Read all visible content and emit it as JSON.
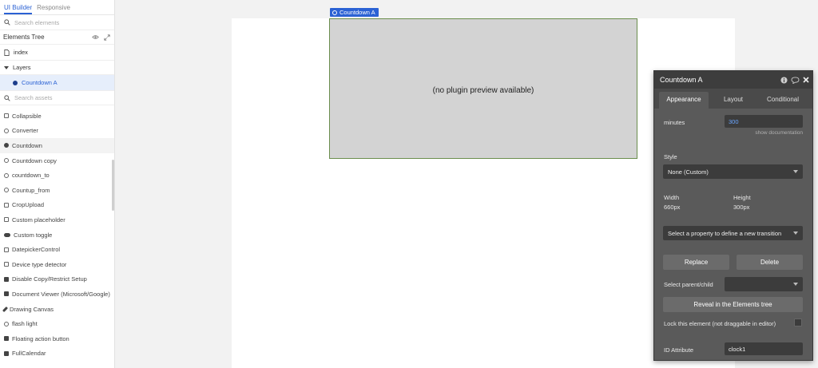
{
  "sidebar": {
    "tabs": [
      "UI Builder",
      "Responsive"
    ],
    "search_elements_placeholder": "Search elements",
    "elements_tree_title": "Elements Tree",
    "page_name": "index",
    "layers_label": "Layers",
    "selected_element": "Countdown A",
    "search_assets_placeholder": "Search assets",
    "assets": [
      "Collapsible",
      "Converter",
      "Countdown",
      "Countdown copy",
      "countdown_to",
      "Countup_from",
      "CropUpload",
      "Custom placeholder",
      "Custom toggle",
      "DatepickerControl",
      "Device type detector",
      "Disable Copy/Restrict Setup",
      "Document Viewer (Microsoft/Google)",
      "Drawing Canvas",
      "flash light",
      "Floating action button",
      "FullCalendar"
    ]
  },
  "canvas": {
    "element_tag": "Countdown A",
    "preview_text": "(no plugin preview available)"
  },
  "panel": {
    "title": "Countdown A",
    "tabs": [
      "Appearance",
      "Layout",
      "Conditional"
    ],
    "minutes_label": "minutes",
    "minutes_value": "300",
    "show_documentation": "show documentation",
    "style_label": "Style",
    "style_value": "None (Custom)",
    "width_label": "Width",
    "width_value": "660px",
    "height_label": "Height",
    "height_value": "300px",
    "transition_placeholder": "Select a property to define a new transition",
    "replace_button": "Replace",
    "delete_button": "Delete",
    "parent_child_label": "Select parent/child",
    "reveal_button": "Reveal in the Elements tree",
    "lock_label": "Lock this element (not draggable in editor)",
    "id_attribute_label": "ID Attribute",
    "id_attribute_value": "clock1"
  },
  "colors": {
    "accent": "#2b62d4",
    "panel_bg": "#5a5a5a",
    "panel_header": "#3d3d3d",
    "element_fill": "#d3d3d3"
  }
}
